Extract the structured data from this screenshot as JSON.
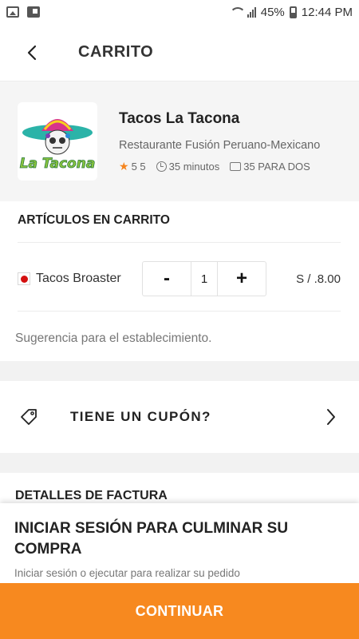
{
  "status_bar": {
    "battery": "45%",
    "time": "12:44 PM"
  },
  "header": {
    "title": "CARRITO"
  },
  "restaurant": {
    "name": "Tacos La Tacona",
    "description": "Restaurante Fusión Peruano-Mexicano",
    "rating": "5 5",
    "delivery_time": "35 minutos",
    "price_for_two": "35 PARA DOS",
    "logo_text": "La Tacona"
  },
  "cart": {
    "section_title": "ARTÍCULOS EN CARRITO",
    "items": [
      {
        "name": "Tacos Broaster",
        "decrement_label": "-",
        "quantity": "1",
        "increment_label": "+",
        "price": "S / .8.00"
      }
    ],
    "suggestion_placeholder": "Sugerencia para el establecimiento."
  },
  "coupon": {
    "label": "TIENE UN CUPÓN?"
  },
  "billing": {
    "title": "DETALLES DE FACTURA"
  },
  "login_prompt": {
    "title": "INICIAR SESIÓN PARA CULMINAR SU COMPRA",
    "subtitle": "Iniciar sesión o ejecutar para realizar su pedido"
  },
  "footer": {
    "continue_label": "CONTINUAR"
  },
  "colors": {
    "accent": "#f7891f",
    "star": "#f5851f",
    "veg_dot": "#d40f0f"
  }
}
